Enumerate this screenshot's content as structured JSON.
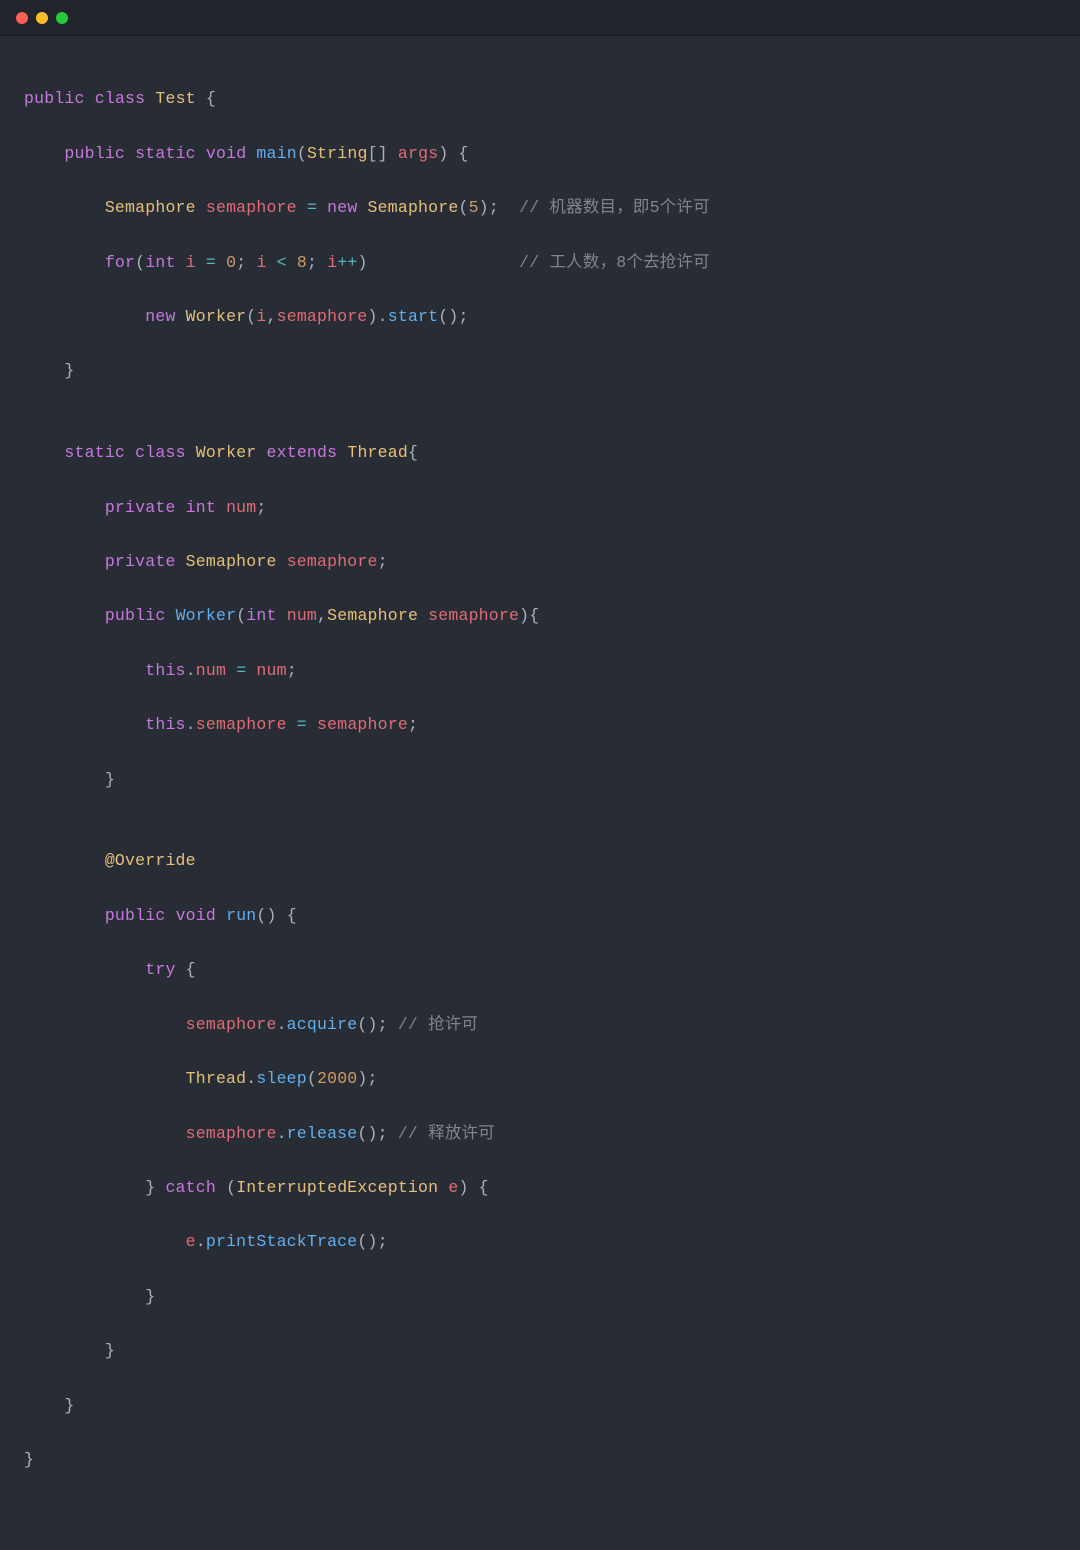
{
  "titlebar": {
    "buttons": [
      "close",
      "minimize",
      "zoom"
    ]
  },
  "code": {
    "l01": {
      "kw1": "public",
      "kw2": "class",
      "cls": "Test",
      "b": "{"
    },
    "l02": {
      "kw1": "public",
      "kw2": "static",
      "kw3": "void",
      "fn": "main",
      "p1": "(",
      "type": "String",
      "br": "[]",
      "arg": "args",
      "p2": ")",
      "b": "{"
    },
    "l03": {
      "type1": "Semaphore",
      "var": "semaphore",
      "eq": "=",
      "kw": "new",
      "type2": "Semaphore",
      "p1": "(",
      "num": "5",
      "p2": ");",
      "cmt": "// 机器数目，即5个许可"
    },
    "l04": {
      "kw": "for",
      "p1": "(",
      "type": "int",
      "var1": "i",
      "eq": "=",
      "num0": "0",
      "sc1": ";",
      "var2": "i",
      "lt": "<",
      "num8": "8",
      "sc2": ";",
      "var3": "i",
      "inc": "++",
      "p2": ")",
      "cmt": "// 工人数，8个去抢许可"
    },
    "l05": {
      "kw": "new",
      "type": "Worker",
      "p1": "(",
      "arg1": "i",
      "comma": ",",
      "arg2": "semaphore",
      "p2": ").",
      "fn": "start",
      "p3": "();"
    },
    "l06": {
      "b": "}"
    },
    "l07": {
      "blank": ""
    },
    "l08": {
      "kw1": "static",
      "kw2": "class",
      "cls": "Worker",
      "kw3": "extends",
      "sup": "Thread",
      "b": "{"
    },
    "l09": {
      "kw": "private",
      "type": "int",
      "var": "num",
      "sc": ";"
    },
    "l10": {
      "kw": "private",
      "type": "Semaphore",
      "var": "semaphore",
      "sc": ";"
    },
    "l11": {
      "kw": "public",
      "fn": "Worker",
      "p1": "(",
      "t1": "int",
      "a1": "num",
      "comma": ",",
      "t2": "Semaphore",
      "a2": "semaphore",
      "p2": "){"
    },
    "l12": {
      "this": "this",
      "dot": ".",
      "field": "num",
      "eq": "=",
      "rhs": "num",
      "sc": ";"
    },
    "l13": {
      "this": "this",
      "dot": ".",
      "field": "semaphore",
      "eq": "=",
      "rhs": "semaphore",
      "sc": ";"
    },
    "l14": {
      "b": "}"
    },
    "l15": {
      "blank": ""
    },
    "l16": {
      "ann": "@Override"
    },
    "l17": {
      "kw1": "public",
      "kw2": "void",
      "fn": "run",
      "p": "()",
      "b": "{"
    },
    "l18": {
      "kw": "try",
      "b": "{"
    },
    "l19": {
      "obj": "semaphore",
      "dot": ".",
      "fn": "acquire",
      "p": "();",
      "cmt": "// 抢许可"
    },
    "l20": {
      "cls": "Thread",
      "dot": ".",
      "fn": "sleep",
      "p1": "(",
      "num": "2000",
      "p2": ");"
    },
    "l21": {
      "obj": "semaphore",
      "dot": ".",
      "fn": "release",
      "p": "();",
      "cmt": "// 释放许可"
    },
    "l22": {
      "b1": "}",
      "kw": "catch",
      "p1": "(",
      "type": "InterruptedException",
      "var": "e",
      "p2": ")",
      "b2": "{"
    },
    "l23": {
      "obj": "e",
      "dot": ".",
      "fn": "printStackTrace",
      "p": "();"
    },
    "l24": {
      "b": "}"
    },
    "l25": {
      "b": "}"
    },
    "l26": {
      "b": "}"
    },
    "l27": {
      "b": "}"
    }
  }
}
